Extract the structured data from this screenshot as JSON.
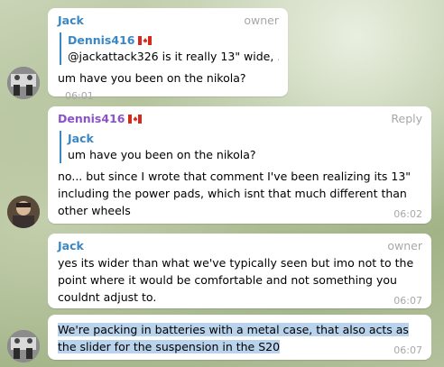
{
  "messages": [
    {
      "sender": "Jack",
      "role": "owner",
      "quote_sender": "Dennis416",
      "quote_text": "@jackattack326 is it really 13\" wide, ...",
      "text": "um have you been on the nikola?",
      "time": "06:01"
    },
    {
      "sender": "Dennis416",
      "action": "Reply",
      "quote_sender": "Jack",
      "quote_text": "um have you been on the nikola?",
      "text": "no... but since I wrote that comment I've been realizing its 13\" including the power pads, which isnt that much different than other wheels",
      "time": "06:02"
    },
    {
      "sender": "Jack",
      "role": "owner",
      "text": "yes its wider than what we've typically seen but imo not to the point where it would be comfortable and not something you couldnt adjust to.",
      "time": "06:07"
    },
    {
      "text": "We're packing in batteries with a metal case, that also acts as the slider for the suspension in the S20",
      "time": "06:07"
    }
  ],
  "colors": {
    "accent_blue": "#3a87c4",
    "name_purple": "#8b52c9",
    "selection": "#b9d3ec"
  }
}
